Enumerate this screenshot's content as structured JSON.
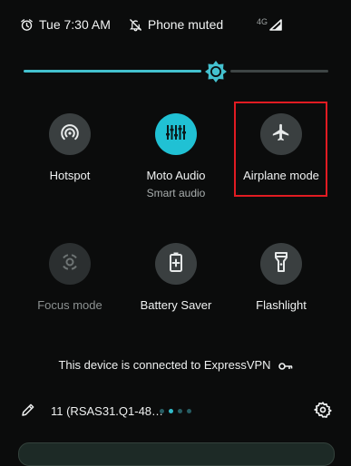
{
  "status_bar": {
    "time": "Tue 7:30 AM",
    "mute_text": "Phone muted",
    "network_type": "4G",
    "icons": [
      "alarm-icon",
      "mute-icon",
      "signal-icon"
    ]
  },
  "brightness": {
    "level": 0.63,
    "accent": "#43c1cf"
  },
  "tiles": [
    {
      "label": "Hotspot",
      "sub": "",
      "icon": "hotspot-icon",
      "state": "off"
    },
    {
      "label": "Moto Audio",
      "sub": "Smart audio",
      "icon": "equalizer-icon",
      "state": "on"
    },
    {
      "label": "Airplane mode",
      "sub": "",
      "icon": "airplane-icon",
      "state": "off",
      "highlighted": true
    },
    {
      "label": "Focus mode",
      "sub": "",
      "icon": "focus-mode-icon",
      "state": "unavailable"
    },
    {
      "label": "Battery Saver",
      "sub": "",
      "icon": "battery-saver-icon",
      "state": "off"
    },
    {
      "label": "Flashlight",
      "sub": "",
      "icon": "flashlight-icon",
      "state": "off"
    }
  ],
  "vpn": {
    "text": "This device is connected to ExpressVPN",
    "icon": "key-icon"
  },
  "footer": {
    "build": "11 (RSAS31.Q1-48…",
    "page_count": 4,
    "active_page": 1,
    "icons": [
      "edit-icon",
      "settings-icon"
    ]
  },
  "colors": {
    "accent": "#20c1d4",
    "highlight": "#e11b22",
    "tile_bg": "#3a3f40",
    "background": "#0b0c0c"
  }
}
